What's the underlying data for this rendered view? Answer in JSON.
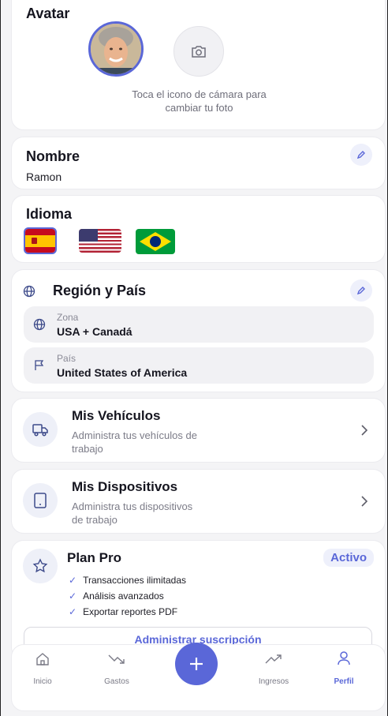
{
  "avatar": {
    "title": "Avatar",
    "hint_line1": "Toca el icono de cámara para",
    "hint_line2": "cambiar tu foto"
  },
  "name": {
    "title": "Nombre",
    "value": "Ramon"
  },
  "language": {
    "title": "Idioma",
    "flags": [
      "spain-flag",
      "usa-flag",
      "brazil-flag"
    ],
    "selected": "spain-flag"
  },
  "region": {
    "title": "Región y País",
    "zone_label": "Zona",
    "zone_value": "USA + Canadá",
    "country_label": "País",
    "country_value": "United States of America"
  },
  "vehicles": {
    "title": "Mis Vehículos",
    "desc_line1": "Administra tus vehículos de",
    "desc_line2": "trabajo"
  },
  "devices": {
    "title": "Mis Dispositivos",
    "desc_line1": "Administra tus dispositivos",
    "desc_line2": "de trabajo"
  },
  "plan": {
    "title": "Plan Pro",
    "badge": "Activo",
    "features": [
      "Transacciones ilimitadas",
      "Análisis avanzados",
      "Exportar reportes PDF"
    ],
    "manage_label": "Administrar suscripción"
  },
  "nav": {
    "items": [
      {
        "label": "Inicio",
        "icon": "home-icon"
      },
      {
        "label": "Gastos",
        "icon": "trending-down-icon"
      },
      {
        "label": "Ingresos",
        "icon": "trending-up-icon"
      },
      {
        "label": "Perfil",
        "icon": "user-icon"
      }
    ],
    "active": "Perfil",
    "fab_icon": "plus-icon"
  },
  "colors": {
    "accent": "#5a67d8",
    "accent_light": "#eef0fb",
    "background": "#f4f4f6"
  }
}
